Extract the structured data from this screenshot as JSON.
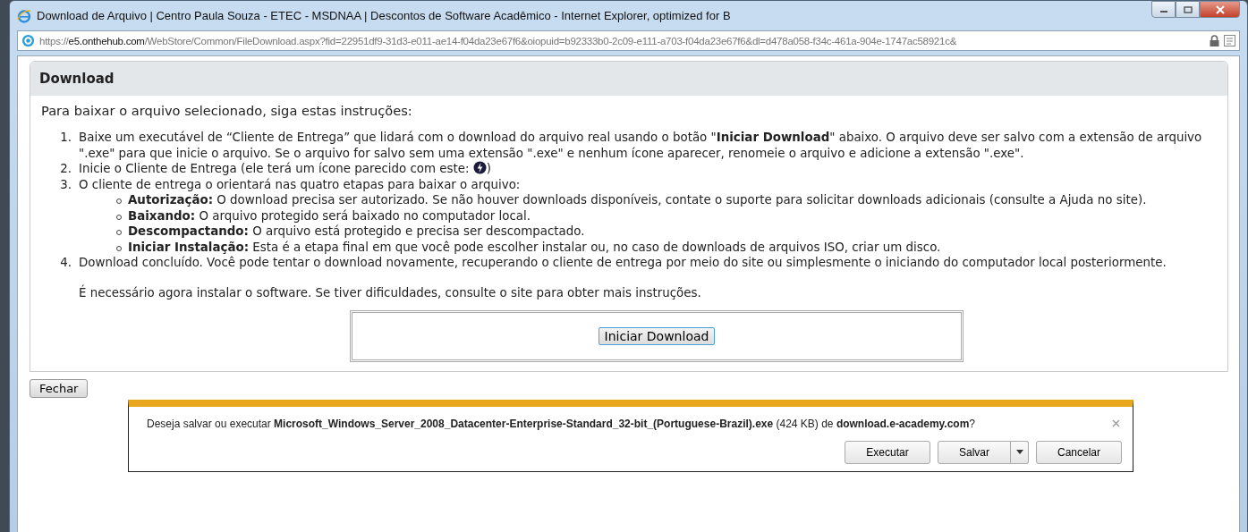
{
  "window": {
    "title": "Download de Arquivo | Centro Paula Souza - ETEC - MSDNAA | Descontos de Software Acadêmico - Internet Explorer, optimized for B"
  },
  "address_bar": {
    "scheme": "https://",
    "host": "e5.onthehub.com",
    "path": "/WebStore/Common/FileDownload.aspx?fid=22951df9-31d3-e011-ae14-f04da23e67f6&oiopuid=b92333b0-2c09-e111-a703-f04da23e67f6&dl=d478a058-f34c-461a-904e-1747ac58921c&"
  },
  "panel": {
    "title": "Download",
    "intro": "Para baixar o arquivo selecionado, siga estas instruções:",
    "steps": [
      {
        "number": "1.",
        "text": "Baixe um executável de “Cliente de Entrega” que lidará com o download do arquivo real usando o botão \"**Iniciar Download**\" abaixo. O arquivo deve ser salvo com a extensão de arquivo \".exe\" para que inicie o arquivo. Se o arquivo for salvo sem uma extensão \".exe\" e nenhum ícone aparecer, renomeie o arquivo e adicione a extensão \".exe\"."
      },
      {
        "number": "2.",
        "text": "Inicie o Cliente de Entrega (ele terá um ícone parecido com este: ",
        "text_after": ")"
      },
      {
        "number": "3.",
        "text": "O cliente de entrega o orientará nas quatro etapas para baixar o arquivo:",
        "substeps": [
          "**Autorização:** O download precisa ser autorizado. Se não houver downloads disponíveis, contate o suporte para solicitar downloads adicionais (consulte a Ajuda no site).",
          "**Baixando:** O arquivo protegido será baixado no computador local.",
          "**Descompactando:** O arquivo está protegido e precisa ser descompactado.",
          "**Iniciar Instalação:** Esta é a etapa final em que você pode escolher instalar ou, no caso de downloads de arquivos ISO, criar um disco."
        ]
      },
      {
        "number": "4.",
        "text": "Download concluído. Você pode tentar o download novamente, recuperando o cliente de entrega por meio do site ou simplesmente o iniciando do computador local posteriormente."
      }
    ],
    "note": "É necessário agora instalar o software. Se tiver dificuldades, consulte o site para obter mais instruções.",
    "start_button": "Iniciar Download"
  },
  "close_button": "Fechar",
  "download_bar": {
    "message": "Deseja salvar ou executar **Microsoft_Windows_Server_2008_Datacenter-Enterprise-Standard_32-bit_(Portuguese-Brazil).exe** (424 KB) de **download.e-academy.com**?",
    "buttons": [
      {
        "label": "Executar",
        "kind": "plain"
      },
      {
        "label": "Salvar",
        "kind": "split"
      },
      {
        "label": "Cancelar",
        "kind": "plain"
      }
    ]
  }
}
